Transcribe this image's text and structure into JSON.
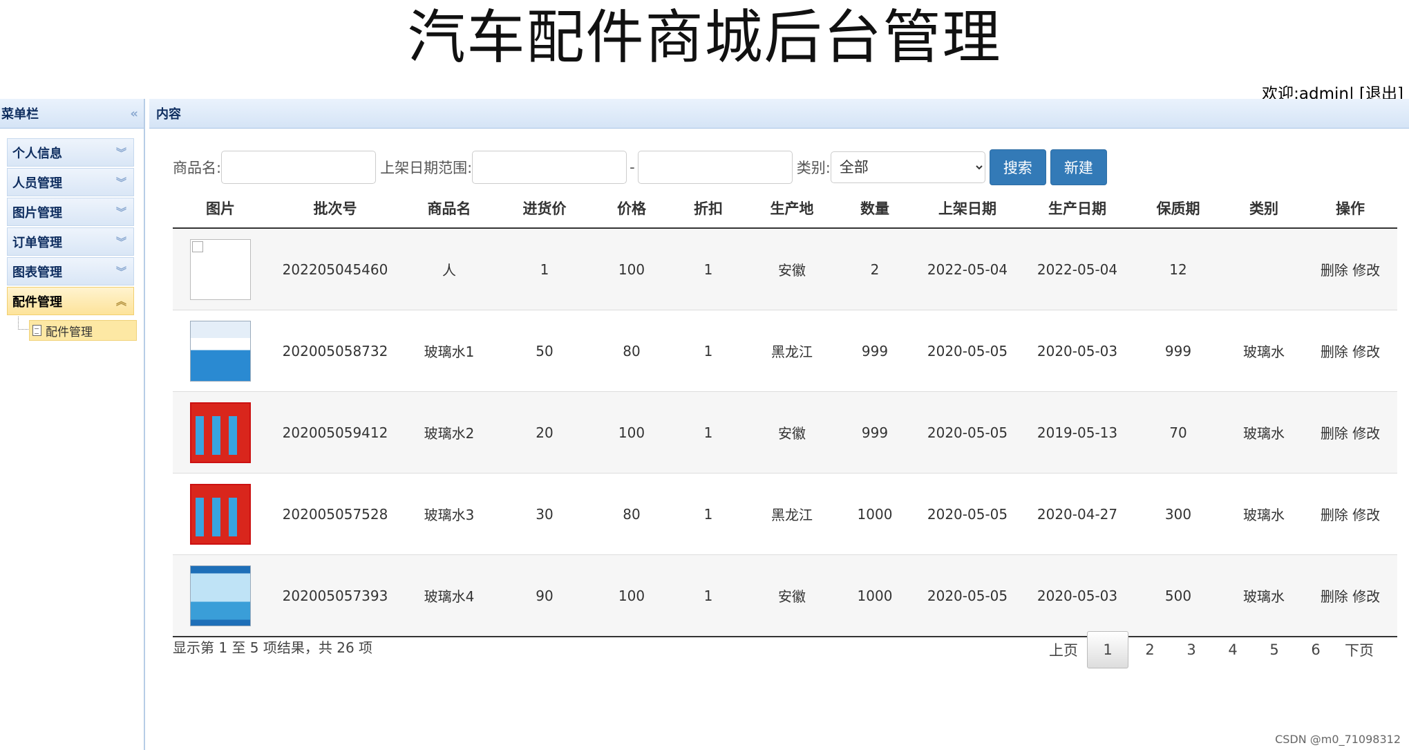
{
  "header": {
    "title": "汽车配件商城后台管理",
    "welcome_prefix": "欢迎:",
    "user": "admin",
    "separator": "|",
    "logout": "[退出]"
  },
  "sidebar": {
    "title": "菜单栏",
    "items": [
      {
        "label": "个人信息"
      },
      {
        "label": "人员管理"
      },
      {
        "label": "图片管理"
      },
      {
        "label": "订单管理"
      },
      {
        "label": "图表管理"
      },
      {
        "label": "配件管理"
      }
    ],
    "subitem": "配件管理"
  },
  "content": {
    "title": "内容"
  },
  "filter": {
    "name_label": "商品名:",
    "date_label": "上架日期范围:",
    "dash": "-",
    "category_label": "类别:",
    "category_value": "全部",
    "search_button": "搜索",
    "new_button": "新建"
  },
  "table": {
    "headers": [
      "图片",
      "批次号",
      "商品名",
      "进货价",
      "价格",
      "折扣",
      "生产地",
      "数量",
      "上架日期",
      "生产日期",
      "保质期",
      "类别",
      "操作"
    ],
    "rows": [
      {
        "batch": "202205045460",
        "name": "人",
        "cost": "1",
        "price": "100",
        "discount": "1",
        "origin": "安徽",
        "qty": "2",
        "listed": "2022-05-04",
        "produced": "2022-05-04",
        "shelf": "12",
        "category": ""
      },
      {
        "batch": "202005058732",
        "name": "玻璃水1",
        "cost": "50",
        "price": "80",
        "discount": "1",
        "origin": "黑龙江",
        "qty": "999",
        "listed": "2020-05-05",
        "produced": "2020-05-03",
        "shelf": "999",
        "category": "玻璃水"
      },
      {
        "batch": "202005059412",
        "name": "玻璃水2",
        "cost": "20",
        "price": "100",
        "discount": "1",
        "origin": "安徽",
        "qty": "999",
        "listed": "2020-05-05",
        "produced": "2019-05-13",
        "shelf": "70",
        "category": "玻璃水"
      },
      {
        "batch": "202005057528",
        "name": "玻璃水3",
        "cost": "30",
        "price": "80",
        "discount": "1",
        "origin": "黑龙江",
        "qty": "1000",
        "listed": "2020-05-05",
        "produced": "2020-04-27",
        "shelf": "300",
        "category": "玻璃水"
      },
      {
        "batch": "202005057393",
        "name": "玻璃水4",
        "cost": "90",
        "price": "100",
        "discount": "1",
        "origin": "安徽",
        "qty": "1000",
        "listed": "2020-05-05",
        "produced": "2020-05-03",
        "shelf": "500",
        "category": "玻璃水"
      }
    ],
    "delete_label": "删除",
    "edit_label": "修改"
  },
  "pagination": {
    "info": "显示第 1 至 5 项结果，共 26 项",
    "prev": "上页",
    "pages": [
      "1",
      "2",
      "3",
      "4",
      "5",
      "6"
    ],
    "next": "下页"
  },
  "watermark": "CSDN @m0_71098312"
}
